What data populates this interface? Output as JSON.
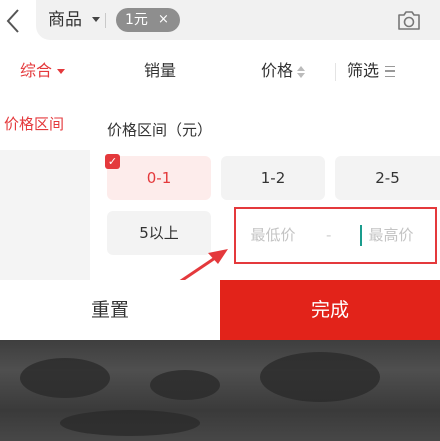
{
  "header": {
    "scope_label": "商品",
    "chip_label": "1元",
    "chip_close": "×"
  },
  "sort": {
    "items": [
      {
        "label": "综合",
        "active": true
      },
      {
        "label": "销量",
        "active": false
      },
      {
        "label": "价格",
        "active": false
      },
      {
        "label": "筛选",
        "active": false
      }
    ]
  },
  "sidebar": {
    "active_label": "价格区间"
  },
  "panel": {
    "title": "价格区间（元）",
    "options": [
      "0-1",
      "1-2",
      "2-5",
      "5以上"
    ],
    "selected_option": "0-1",
    "min_placeholder": "最低价",
    "max_placeholder": "最高价",
    "range_dash": "-"
  },
  "footer": {
    "reset_label": "重置",
    "done_label": "完成"
  },
  "colors": {
    "accent": "#e4393c",
    "done_button": "#e2231a",
    "cursor": "#1a9c8d"
  },
  "icons": [
    "back-arrow-icon",
    "caret-down-icon",
    "camera-icon",
    "sort-updown-icon",
    "filter-lines-icon",
    "check-icon"
  ]
}
